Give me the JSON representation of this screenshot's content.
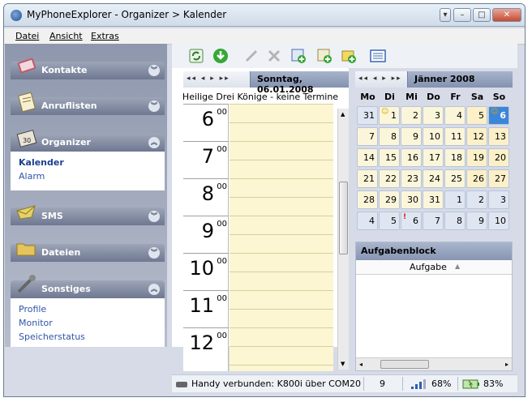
{
  "window": {
    "title": "MyPhoneExplorer -  Organizer > Kalender"
  },
  "menu": [
    "Datei",
    "Ansicht",
    "Extras"
  ],
  "sidebar": {
    "sections": [
      {
        "label": "Kontakte",
        "icon": "address-book-icon"
      },
      {
        "label": "Anruflisten",
        "icon": "call-list-icon"
      },
      {
        "label": "Organizer",
        "icon": "organizer-icon",
        "items": [
          "Kalender",
          "Alarm"
        ]
      },
      {
        "label": "SMS",
        "icon": "sms-icon"
      },
      {
        "label": "Dateien",
        "icon": "folder-icon"
      },
      {
        "label": "Sonstiges",
        "icon": "tools-icon",
        "items": [
          "Profile",
          "Monitor",
          "Speicherstatus"
        ]
      }
    ]
  },
  "toolbar": [
    "refresh-icon",
    "download-icon",
    "edit-icon",
    "delete-icon",
    "new-appointment-icon",
    "new-note-icon",
    "new-task-icon",
    "list-view-icon"
  ],
  "dayview": {
    "date_label": "Sonntag, 06.01.2008",
    "holiday": "Heilige Drei Könige - keine Termine",
    "hours": [
      "6",
      "7",
      "8",
      "9",
      "10",
      "11",
      "12"
    ],
    "minutes": "00"
  },
  "calendar": {
    "month_label": "Jänner 2008",
    "weekdays": [
      "Mo",
      "Di",
      "Mi",
      "Do",
      "Fr",
      "Sa",
      "So"
    ],
    "weeks": [
      [
        "31",
        "1",
        "2",
        "3",
        "4",
        "5",
        "6"
      ],
      [
        "7",
        "8",
        "9",
        "10",
        "11",
        "12",
        "13"
      ],
      [
        "14",
        "15",
        "16",
        "17",
        "18",
        "19",
        "20"
      ],
      [
        "21",
        "22",
        "23",
        "24",
        "25",
        "26",
        "27"
      ],
      [
        "28",
        "29",
        "30",
        "31",
        "1",
        "2",
        "3"
      ],
      [
        "4",
        "5",
        "6",
        "7",
        "8",
        "9",
        "10"
      ]
    ],
    "today": "6"
  },
  "tasks": {
    "title": "Aufgabenblock",
    "column": "Aufgabe"
  },
  "status": {
    "connection": "Handy verbunden: K800i über COM20",
    "count": "9",
    "signal": "68%",
    "battery": "83%"
  }
}
